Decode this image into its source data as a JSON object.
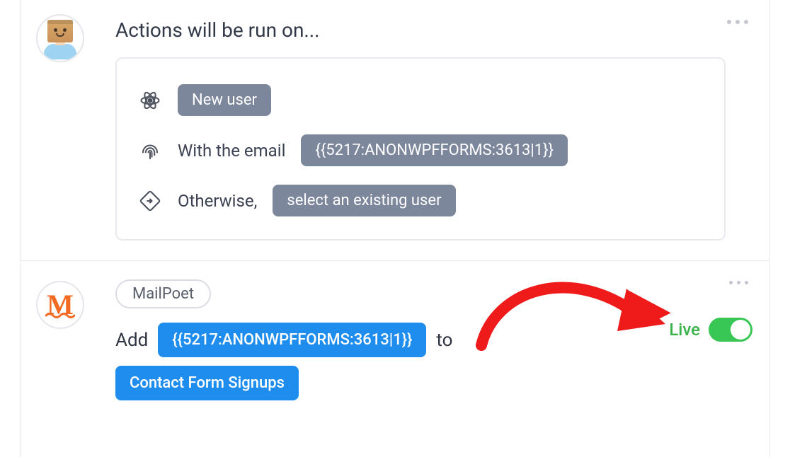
{
  "section_actions": {
    "title": "Actions will be run on...",
    "rule_new_user": {
      "label": "New user"
    },
    "rule_email": {
      "prefix": "With the email",
      "token": "{{5217:ANONWPFFORMS:3613|1}}"
    },
    "rule_otherwise": {
      "prefix": "Otherwise,",
      "label": "select an existing user"
    }
  },
  "section_action": {
    "integration_tag": "MailPoet",
    "verb": "Add",
    "token": "{{5217:ANONWPFFORMS:3613|1}}",
    "joiner": "to",
    "list_name": "Contact Form Signups",
    "status_label": "Live",
    "status_on": true
  }
}
